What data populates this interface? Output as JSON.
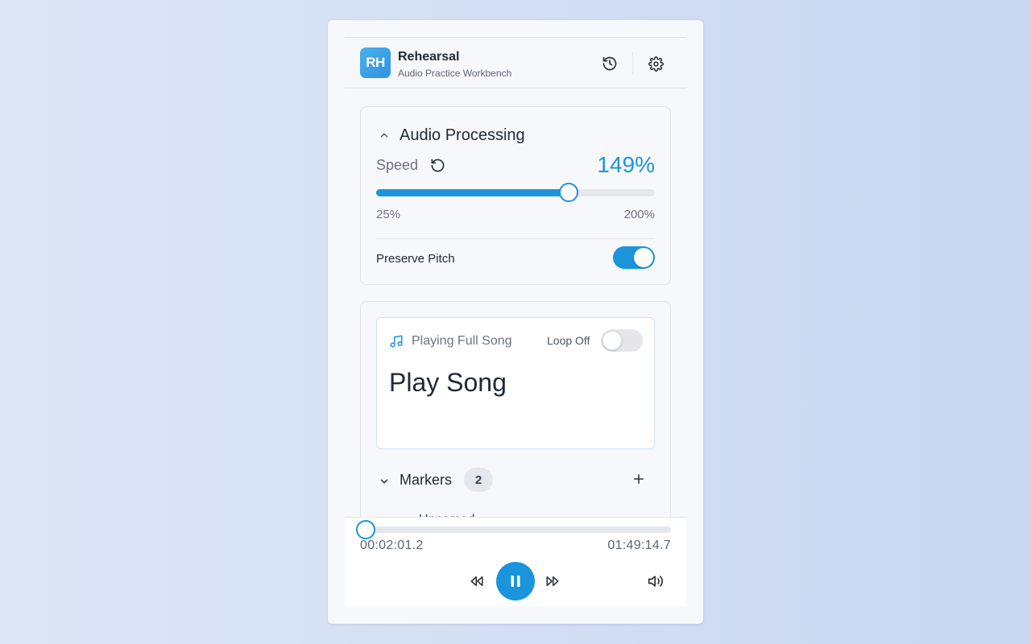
{
  "app": {
    "logo_text": "RH",
    "title": "Rehearsal",
    "subtitle": "Audio Practice Workbench"
  },
  "header": {
    "icons": [
      "history-icon",
      "settings-gear-icon"
    ]
  },
  "audio_processing": {
    "title": "Audio Processing",
    "expanded": true,
    "speed_label": "Speed",
    "speed_value": "149%",
    "speed_min": "25%",
    "speed_max": "200%",
    "speed_fraction": 0.69,
    "preserve_pitch_label": "Preserve Pitch",
    "preserve_pitch": true
  },
  "song": {
    "mode_label": "Playing Full Song",
    "loop_label": "Loop Off",
    "loop_enabled": false,
    "title": "Play Song"
  },
  "markers": {
    "title": "Markers",
    "count": "2",
    "expanded": true,
    "first_item_partial": "Unnamed"
  },
  "player": {
    "current_time": "00:02:01.2",
    "total_time": "01:49:14.7",
    "progress_fraction": 0.018,
    "state": "playing"
  },
  "colors": {
    "accent": "#1a95dc",
    "background_start": "#dde6f6",
    "background_end": "#c8d8f2"
  }
}
